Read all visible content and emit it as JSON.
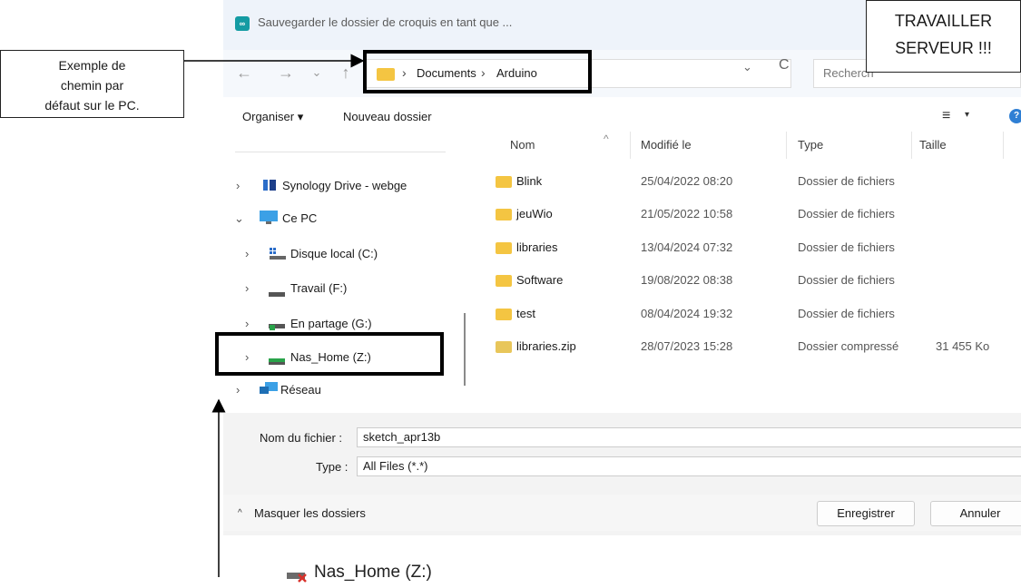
{
  "window": {
    "title": "Sauvegarder le dossier de croquis en tant que ..."
  },
  "nav": {
    "back": "←",
    "forward": "→",
    "recent": "⌄",
    "up": "↑"
  },
  "address": {
    "segments": [
      "Documents",
      "Arduino"
    ],
    "separator": "›",
    "dropdown": "⌄",
    "refresh": "C",
    "search_placeholder": "Recherch"
  },
  "toolbar": {
    "organise": "Organiser ▾",
    "new_folder": "Nouveau dossier",
    "view": "≡",
    "view_chev": "▾",
    "help": "?"
  },
  "navpane": {
    "items": [
      {
        "label": "Synology Drive - webge",
        "icon": "synology-icon",
        "chev": "›"
      },
      {
        "label": "Ce PC",
        "icon": "computer-icon",
        "chev": "⌄"
      },
      {
        "label": "Disque local (C:)",
        "icon": "local-disk-icon",
        "chev": "›"
      },
      {
        "label": "Travail (F:)",
        "icon": "drive-icon",
        "chev": "›"
      },
      {
        "label": "En partage (G:)",
        "icon": "network-drive-icon",
        "chev": "›"
      },
      {
        "label": "Nas_Home (Z:)",
        "icon": "nas-drive-icon",
        "chev": "›"
      },
      {
        "label": "Réseau",
        "icon": "network-icon",
        "chev": "›"
      }
    ]
  },
  "filelist": {
    "columns": [
      "Nom",
      "Modifié le",
      "Type",
      "Taille"
    ],
    "rows": [
      {
        "name": "Blink",
        "date": "25/04/2022 08:20",
        "type": "Dossier de fichiers",
        "size": ""
      },
      {
        "name": "jeuWio",
        "date": "21/05/2022 10:58",
        "type": "Dossier de fichiers",
        "size": ""
      },
      {
        "name": "libraries",
        "date": "13/04/2024 07:32",
        "type": "Dossier de fichiers",
        "size": ""
      },
      {
        "name": "Software",
        "date": "19/08/2022 08:38",
        "type": "Dossier de fichiers",
        "size": ""
      },
      {
        "name": "test",
        "date": "08/04/2024 19:32",
        "type": "Dossier de fichiers",
        "size": ""
      },
      {
        "name": "libraries.zip",
        "date": "28/07/2023 15:28",
        "type": "Dossier compressé",
        "size": "31 455 Ko"
      }
    ]
  },
  "bottom": {
    "filename_label": "Nom du fichier :",
    "filename_value": "sketch_apr13b",
    "type_label": "Type :",
    "type_value": "All Files (*.*)",
    "hide_folders": "Masquer les dossiers",
    "save": "Enregistrer",
    "cancel": "Annuler"
  },
  "annotations": {
    "note_line1": "Exemple de",
    "note_line2": "chemin par",
    "note_line3": "défaut sur le PC.",
    "warn_line1": "TRAVAILLER",
    "warn_line2": "SERVEUR !!!",
    "bottom_drive": "Nas_Home (Z:)"
  },
  "colors": {
    "folder": "#f4c542",
    "accent": "#2f7fd4",
    "titlebar": "#eef3fa"
  }
}
